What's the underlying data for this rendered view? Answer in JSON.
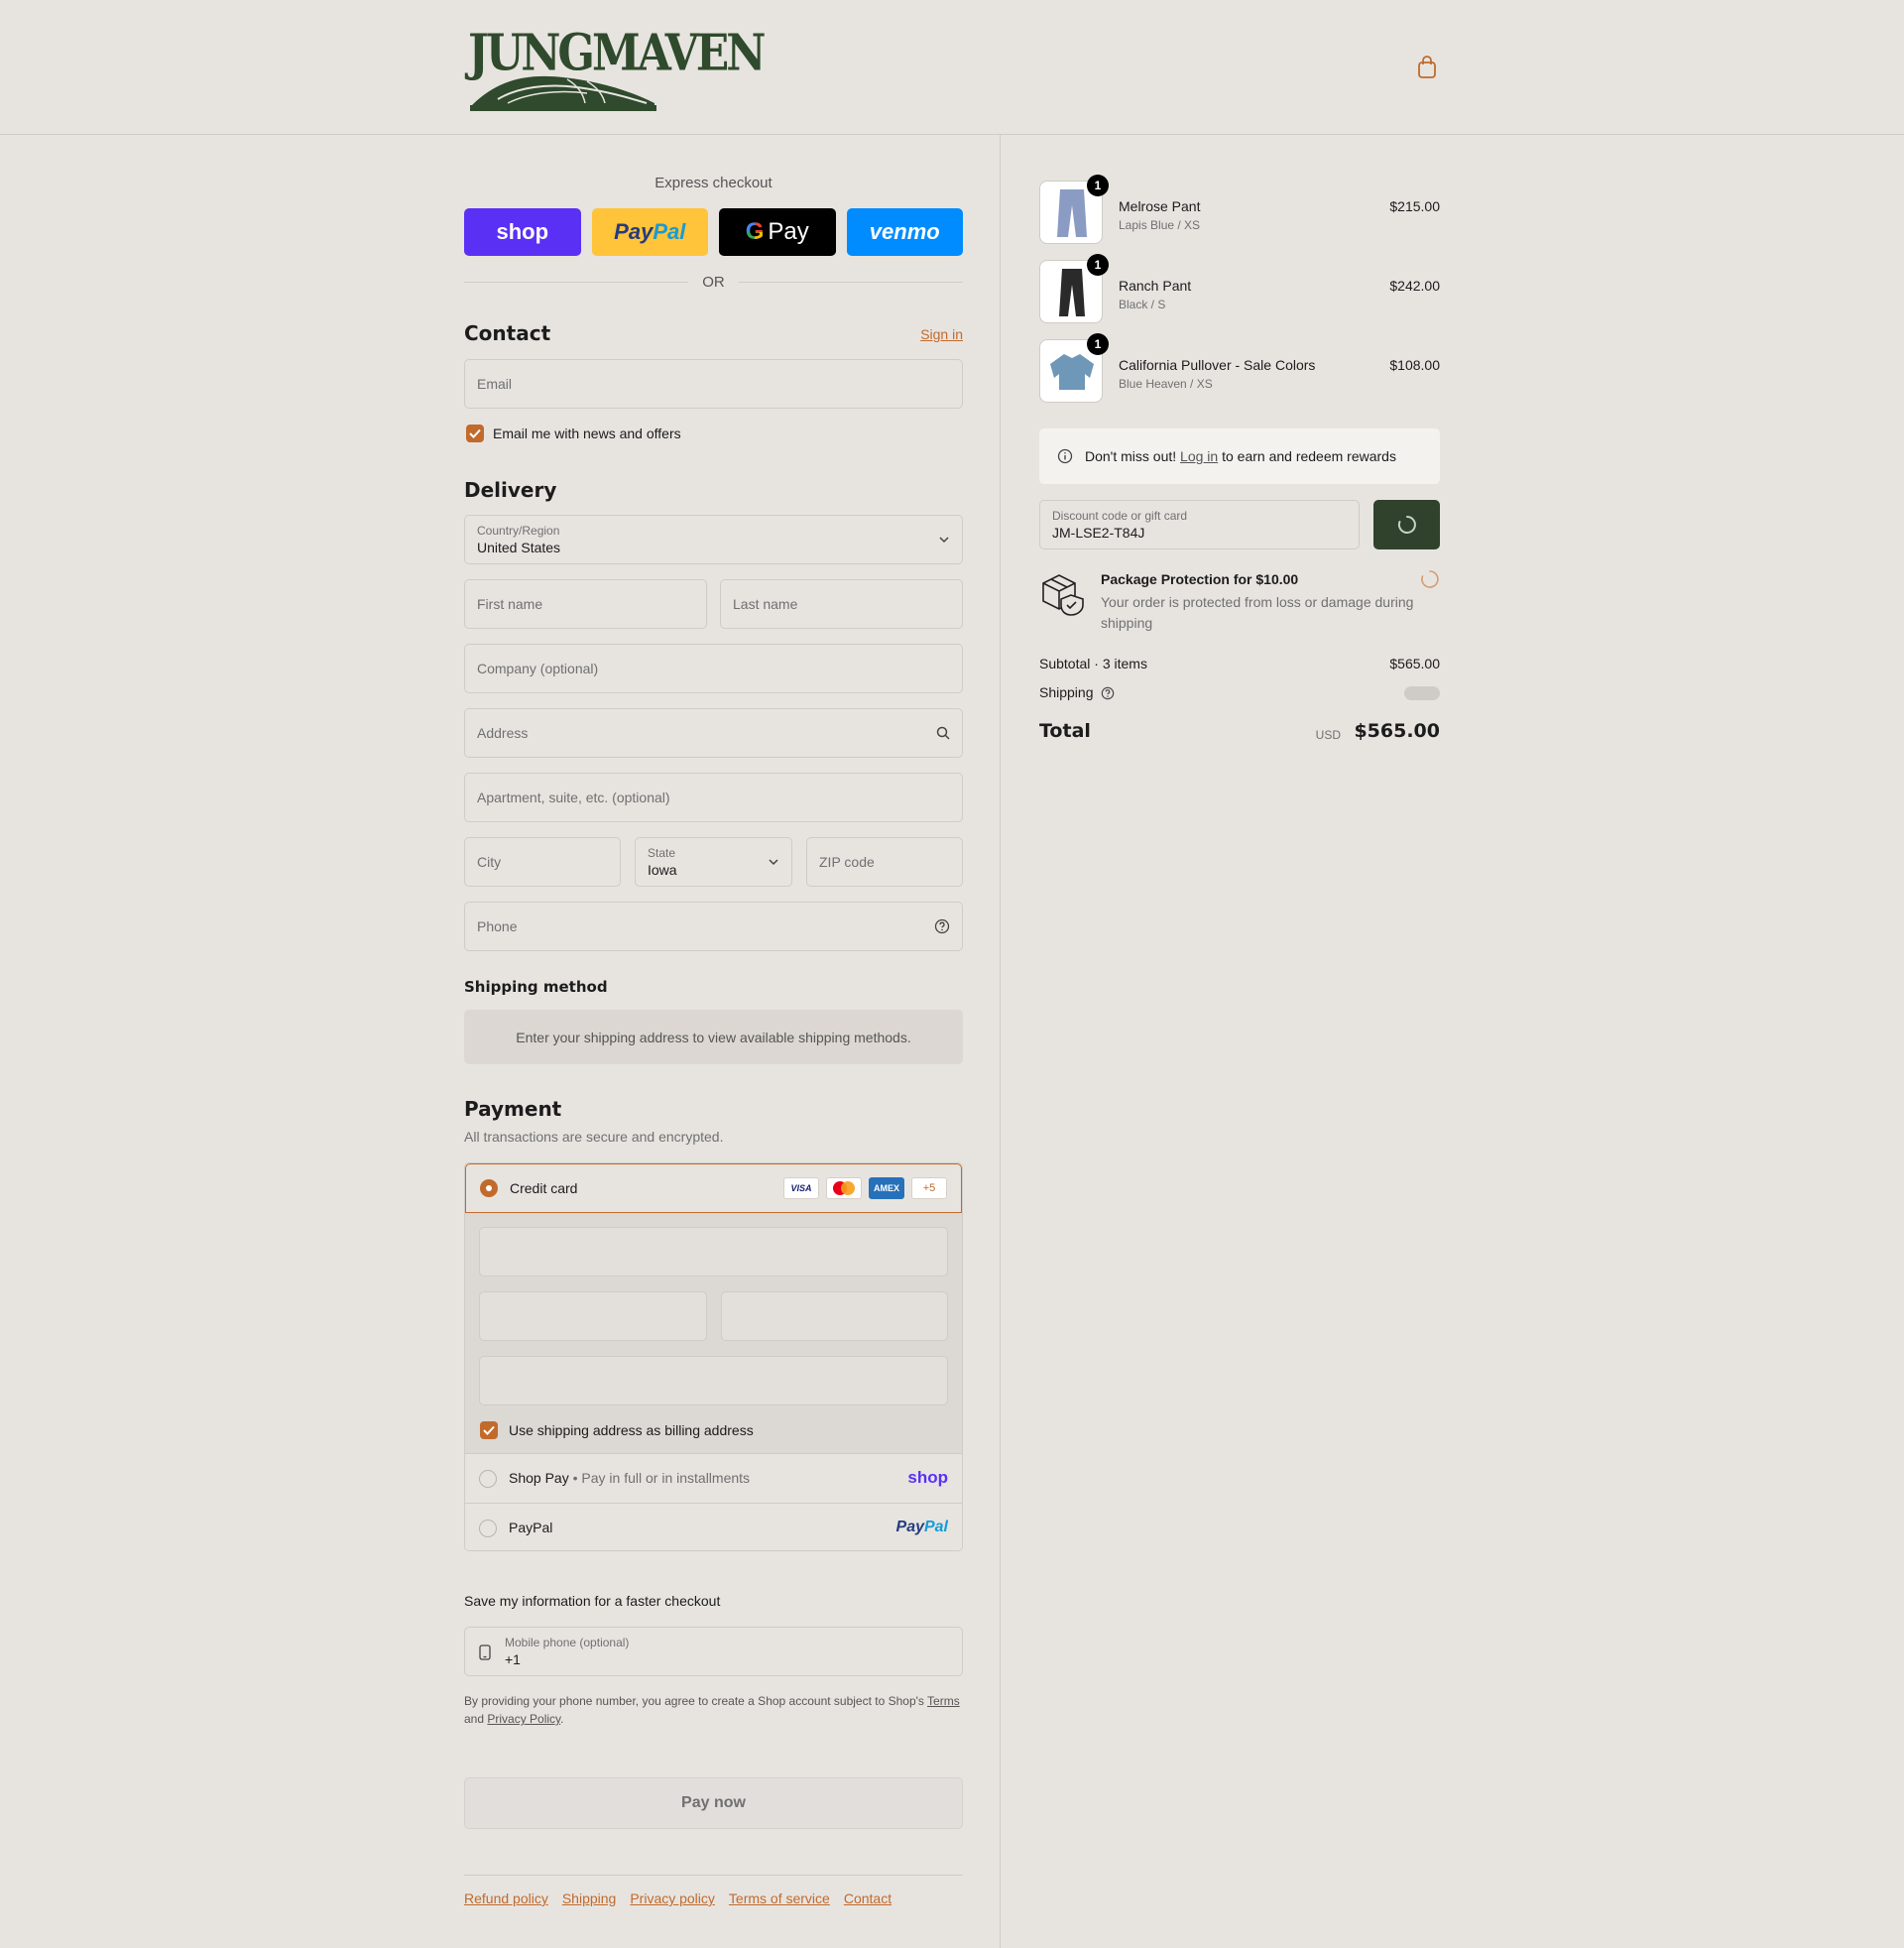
{
  "brand": {
    "logo_text": "JUNGMAVEN"
  },
  "header": {
    "cart_icon": "shopping-bag-icon"
  },
  "express": {
    "title": "Express checkout",
    "buttons": {
      "shop": "shop",
      "paypal_a": "Pay",
      "paypal_b": "Pal",
      "gpay_g": "G",
      "gpay": "Pay",
      "venmo": "venmo"
    },
    "divider": "OR"
  },
  "contact": {
    "title": "Contact",
    "sign_in": "Sign in",
    "email_placeholder": "Email",
    "news_label": "Email me with news and offers",
    "news_checked": true
  },
  "delivery": {
    "title": "Delivery",
    "country_label": "Country/Region",
    "country_value": "United States",
    "first_name": "First name",
    "last_name": "Last name",
    "company": "Company (optional)",
    "address": "Address",
    "apartment": "Apartment, suite, etc. (optional)",
    "city": "City",
    "state_label": "State",
    "state_value": "Iowa",
    "zip": "ZIP code",
    "phone": "Phone"
  },
  "shipping_method": {
    "title": "Shipping method",
    "message": "Enter your shipping address to view available shipping methods."
  },
  "payment": {
    "title": "Payment",
    "subtitle": "All transactions are secure and encrypted.",
    "credit_card": "Credit card",
    "card_logos": {
      "visa": "VISA",
      "amex": "AMEX",
      "more": "+5"
    },
    "billing_label": "Use shipping address as billing address",
    "shop_pay": "Shop Pay",
    "shop_pay_sub": "Pay in full or in installments",
    "shop_pay_logo": "shop",
    "paypal": "PayPal",
    "paypal_logo_a": "Pay",
    "paypal_logo_b": "Pal"
  },
  "save_info": {
    "title": "Save my information for a faster checkout",
    "phone_label": "Mobile phone (optional)",
    "phone_value": "+1",
    "legal_a": "By providing your phone number, you agree to create a Shop account subject to Shop's",
    "terms": "Terms",
    "legal_b": "and",
    "privacy": "Privacy Policy",
    "legal_c": "."
  },
  "pay_now": "Pay now",
  "footer": {
    "links": [
      "Refund policy",
      "Shipping",
      "Privacy policy",
      "Terms of service",
      "Contact"
    ]
  },
  "cart": {
    "items": [
      {
        "name": "Melrose Pant",
        "variant": "Lapis Blue / XS",
        "price": "$215.00",
        "qty": "1",
        "color": "#8a9cc4"
      },
      {
        "name": "Ranch Pant",
        "variant": "Black / S",
        "price": "$242.00",
        "qty": "1",
        "color": "#2a2a2a"
      },
      {
        "name": "California Pullover - Sale Colors",
        "variant": "Blue Heaven / XS",
        "price": "$108.00",
        "qty": "1",
        "color": "#6f97b8"
      }
    ],
    "rewards_a": "Don't miss out!",
    "rewards_link": "Log in",
    "rewards_b": "to earn and redeem rewards",
    "discount_label": "Discount code or gift card",
    "discount_value": "JM-LSE2-T84J",
    "protection_title": "Package Protection for $10.00",
    "protection_desc": "Your order is protected from loss or damage during shipping",
    "subtotal_label": "Subtotal · 3 items",
    "subtotal_value": "$565.00",
    "shipping_label": "Shipping",
    "total_label": "Total",
    "currency": "USD",
    "total_value": "$565.00"
  },
  "colors": {
    "accent": "#c16a2c",
    "brand_green": "#30412c",
    "background": "#e7e4e0"
  }
}
